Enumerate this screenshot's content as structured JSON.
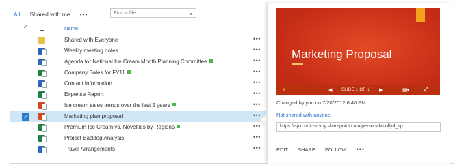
{
  "tabs": {
    "all": "All",
    "shared_with_me": "Shared with me",
    "more": "•••"
  },
  "search": {
    "placeholder": "Find a file"
  },
  "list": {
    "header_name": "Name",
    "rows": [
      {
        "name": "Shared with Everyone",
        "type": "folder",
        "is_new": false,
        "selected": false
      },
      {
        "name": "Weekly meeting notes",
        "type": "word",
        "is_new": false,
        "selected": false
      },
      {
        "name": "Agenda for National Ice Cream Month Planning Committee",
        "type": "word",
        "is_new": true,
        "selected": false
      },
      {
        "name": "Company Sales for FY11",
        "type": "excel",
        "is_new": true,
        "selected": false
      },
      {
        "name": "Contact Information",
        "type": "word",
        "is_new": false,
        "selected": false
      },
      {
        "name": "Expense Report",
        "type": "excel",
        "is_new": false,
        "selected": false
      },
      {
        "name": "Ice cream sales trends over the last 5 years",
        "type": "ppt",
        "is_new": true,
        "selected": false
      },
      {
        "name": "Marketing plan proposal",
        "type": "ppt",
        "is_new": false,
        "selected": true
      },
      {
        "name": "Premium Ice Cream vs. Novelties by Regions",
        "type": "excel",
        "is_new": true,
        "selected": false
      },
      {
        "name": "Project Backlog Analysis",
        "type": "excel",
        "is_new": false,
        "selected": false
      },
      {
        "name": "Travel Arrangements",
        "type": "word",
        "is_new": false,
        "selected": false
      }
    ],
    "row_menu": "•••"
  },
  "callout": {
    "slide_title": "Marketing Proposal",
    "slide_counter": "SLIDE 1 OF 1",
    "changed_by": "Changed by you on 7/20/2012 6:40 PM",
    "sharing_status": "Not shared with anyone",
    "url": "https://spxcontoso-my.sharepoint.com/personal/mollyd_sp",
    "actions": {
      "edit": "EDIT",
      "share": "SHARE",
      "follow": "FOLLOW",
      "more": "•••"
    }
  },
  "colors": {
    "accent": "#2a6fc9",
    "selection": "#cfe6f7",
    "slide_background": "#d5351d",
    "new_badge": "#4cb649"
  }
}
